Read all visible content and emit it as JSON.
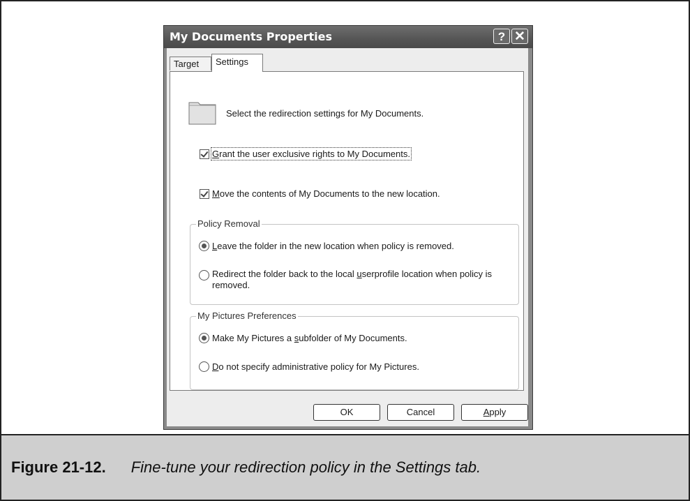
{
  "dialog": {
    "title": "My Documents Properties",
    "help_glyph": "?",
    "close_glyph": "✕"
  },
  "tabs": [
    {
      "label": "Target",
      "active": false
    },
    {
      "label": "Settings",
      "active": true
    }
  ],
  "settings": {
    "intro_text": "Select the redirection settings for My Documents.",
    "grant_rights": {
      "checked": true,
      "accel": "G",
      "rest": "rant the user exclusive rights to My Documents."
    },
    "move_contents": {
      "checked": true,
      "accel": "M",
      "rest": "ove the contents of My Documents to the new location."
    },
    "policy_removal": {
      "legend": "Policy Removal",
      "leave": {
        "selected": true,
        "accel": "L",
        "rest": "eave the folder in the new location when policy is removed."
      },
      "redirect": {
        "selected": false,
        "pre": "Redirect the folder back to the local ",
        "accel": "u",
        "post": "serprofile location when policy is removed."
      }
    },
    "my_pictures": {
      "legend": "My Pictures Preferences",
      "make_subfolder": {
        "selected": true,
        "pre": "Make My Pictures a ",
        "accel": "s",
        "post": "ubfolder of My Documents."
      },
      "do_not_specify": {
        "selected": false,
        "accel": "D",
        "rest": "o not specify administrative policy for My Pictures."
      }
    }
  },
  "buttons": {
    "ok": "OK",
    "cancel": "Cancel",
    "apply_accel": "A",
    "apply_rest": "pply"
  },
  "caption": {
    "label": "Figure 21-12.",
    "text": "Fine-tune your redirection policy in the Settings tab."
  },
  "icons": {
    "folder": "folder-icon"
  }
}
